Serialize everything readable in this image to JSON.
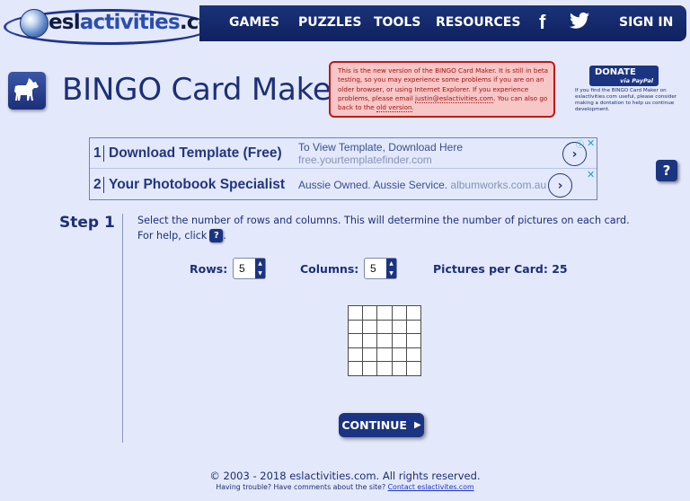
{
  "header": {
    "logo": {
      "prefix": "esl",
      "highlight": "activities",
      "suffix": ".com"
    },
    "nav": [
      {
        "label": "GAMES"
      },
      {
        "label": "PUZZLES"
      },
      {
        "label": "TOOLS"
      },
      {
        "label": "RESOURCES"
      }
    ],
    "social": [
      {
        "icon": "facebook-icon",
        "glyph": "f"
      },
      {
        "icon": "twitter-icon",
        "glyph": "🐦"
      }
    ],
    "sign_in_label": "SIGN IN"
  },
  "page": {
    "title": "BINGO Card Maker",
    "icon": "dog-icon"
  },
  "notice": {
    "text_before_email": "This is the new version of the BINGO Card Maker. It is still in beta testing, so you may experience some problems if you are on an older browser, or using Internet Explorer. If you experience problems, please email ",
    "email": "justin@eslactivities.com",
    "text_middle": ". You can also go back to the ",
    "old_version_link": "old version",
    "text_after": "."
  },
  "donate": {
    "button_main": "DONATE",
    "button_sub": "via PayPal",
    "note": "If you find the BINGO Card Maker on eslactivities.com useful, please consider making a dontation to help us continue development."
  },
  "ads": [
    {
      "num": "1",
      "title": "Download Template (Free)",
      "desc_line1": "To View Template, Download Here",
      "desc_line2": "free.yourtemplatefinder.com"
    },
    {
      "num": "2",
      "title": "Your Photobook Specialist",
      "desc_line1": "Aussie Owned. Aussie Service.",
      "desc_line2": "albumworks.com.au"
    }
  ],
  "help_button": "?",
  "step": {
    "label": "Step 1",
    "instructions": "Select the number of rows and columns. This will determine the number of pictures on each card.",
    "help_prefix": "For help, click",
    "help_suffix": ".",
    "rows_label": "Rows:",
    "rows_value": "5",
    "columns_label": "Columns:",
    "columns_value": "5",
    "pictures_label": "Pictures per Card:",
    "pictures_value": "25",
    "grid": {
      "rows": 5,
      "columns": 5
    },
    "continue_label": "CONTINUE"
  },
  "footer": {
    "copyright": "© 2003 - 2018 eslactivities.com. All rights reserved.",
    "help_text": "Having trouble? Have comments about the site?",
    "contact_link": "Contact eslactivites.com"
  }
}
